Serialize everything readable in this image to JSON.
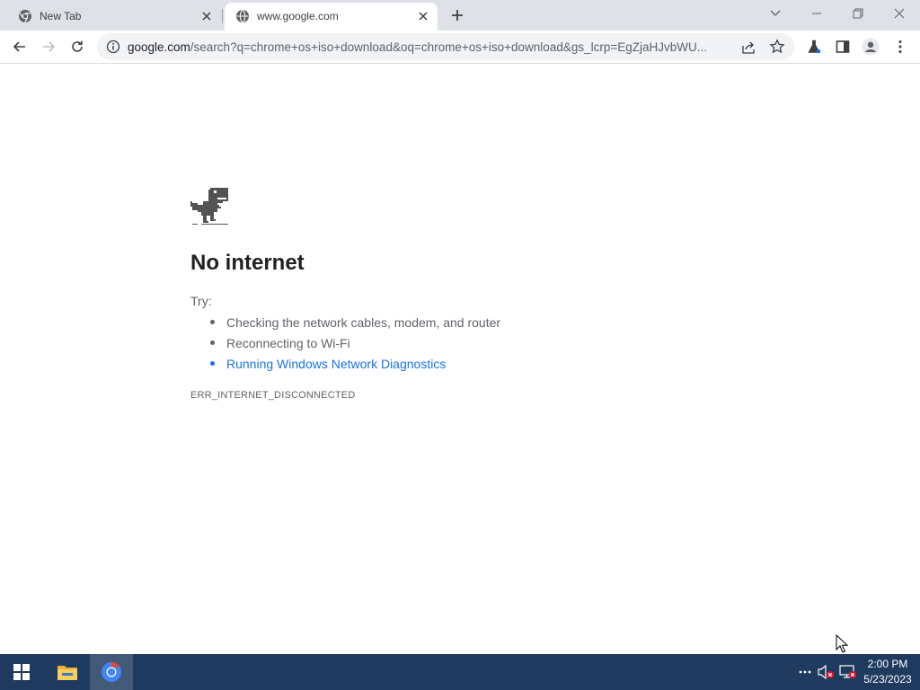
{
  "browser": {
    "tabs": [
      {
        "title": "New Tab",
        "favicon": "chrome-icon",
        "active": false
      },
      {
        "title": "www.google.com",
        "favicon": "globe-icon",
        "active": true
      }
    ],
    "address_bar": {
      "host": "google.com",
      "path": "/search?q=chrome+os+iso+download&oq=chrome+os+iso+download&gs_lcrp=EgZjaHJvbWU..."
    }
  },
  "error_page": {
    "heading": "No internet",
    "try_label": "Try:",
    "suggestions": [
      "Checking the network cables, modem, and router",
      "Reconnecting to Wi-Fi",
      "Running Windows Network Diagnostics"
    ],
    "error_code": "ERR_INTERNET_DISCONNECTED"
  },
  "taskbar": {
    "items": [
      "start-icon",
      "file-explorer-icon",
      "chrome-icon"
    ],
    "tray": [
      "overflow-icon",
      "volume-muted-icon",
      "network-disconnected-icon"
    ],
    "clock": {
      "time": "2:00 PM",
      "date": "5/23/2023"
    }
  },
  "colors": {
    "tab_strip": "#dee1e6",
    "link": "#1a73e8",
    "taskbar": "#1f3a5f"
  }
}
